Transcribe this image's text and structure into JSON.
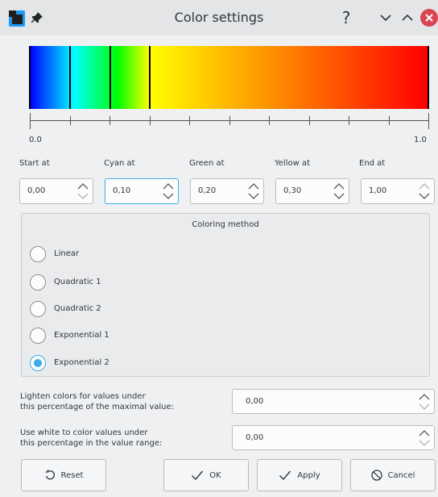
{
  "window": {
    "title": "Color settings",
    "help_glyph": "?",
    "accent": "#3daee9",
    "close_color": "#da4453"
  },
  "gradient": {
    "stops": [
      "#0000ff",
      "#00ffff",
      "#00ff00",
      "#ffff00",
      "#ff0000"
    ],
    "marker_values": [
      0.1,
      0.2,
      0.3
    ],
    "scale_min": "0.0",
    "scale_max": "1.0"
  },
  "thresholds": [
    {
      "label": "Start at",
      "value": "0,00",
      "focused": false
    },
    {
      "label": "Cyan at",
      "value": "0,10",
      "focused": true
    },
    {
      "label": "Green at",
      "value": "0,20",
      "focused": false
    },
    {
      "label": "Yellow at",
      "value": "0,30",
      "focused": false
    },
    {
      "label": "End at",
      "value": "1,00",
      "focused": false
    }
  ],
  "coloring": {
    "title": "Coloring method",
    "options": [
      "Linear",
      "Quadratic 1",
      "Quadratic 2",
      "Exponential 1",
      "Exponential 2"
    ],
    "selected": "Exponential 2"
  },
  "lighten": {
    "label_line1": "Lighten colors for values under",
    "label_line2": "this percentage of the maximal value:",
    "value": "0,00"
  },
  "white": {
    "label_line1": "Use white to color values under",
    "label_line2": "this percentage in the value range:",
    "value": "0,00"
  },
  "buttons": {
    "reset": "Reset",
    "ok": "OK",
    "apply": "Apply",
    "cancel": "Cancel"
  },
  "icons": [
    "app-icon",
    "pin-icon",
    "help-icon",
    "minimize-icon",
    "maximize-icon",
    "close-icon",
    "reset-icon",
    "check-icon",
    "cancel-icon",
    "chevron-up-icon",
    "chevron-down-icon"
  ]
}
